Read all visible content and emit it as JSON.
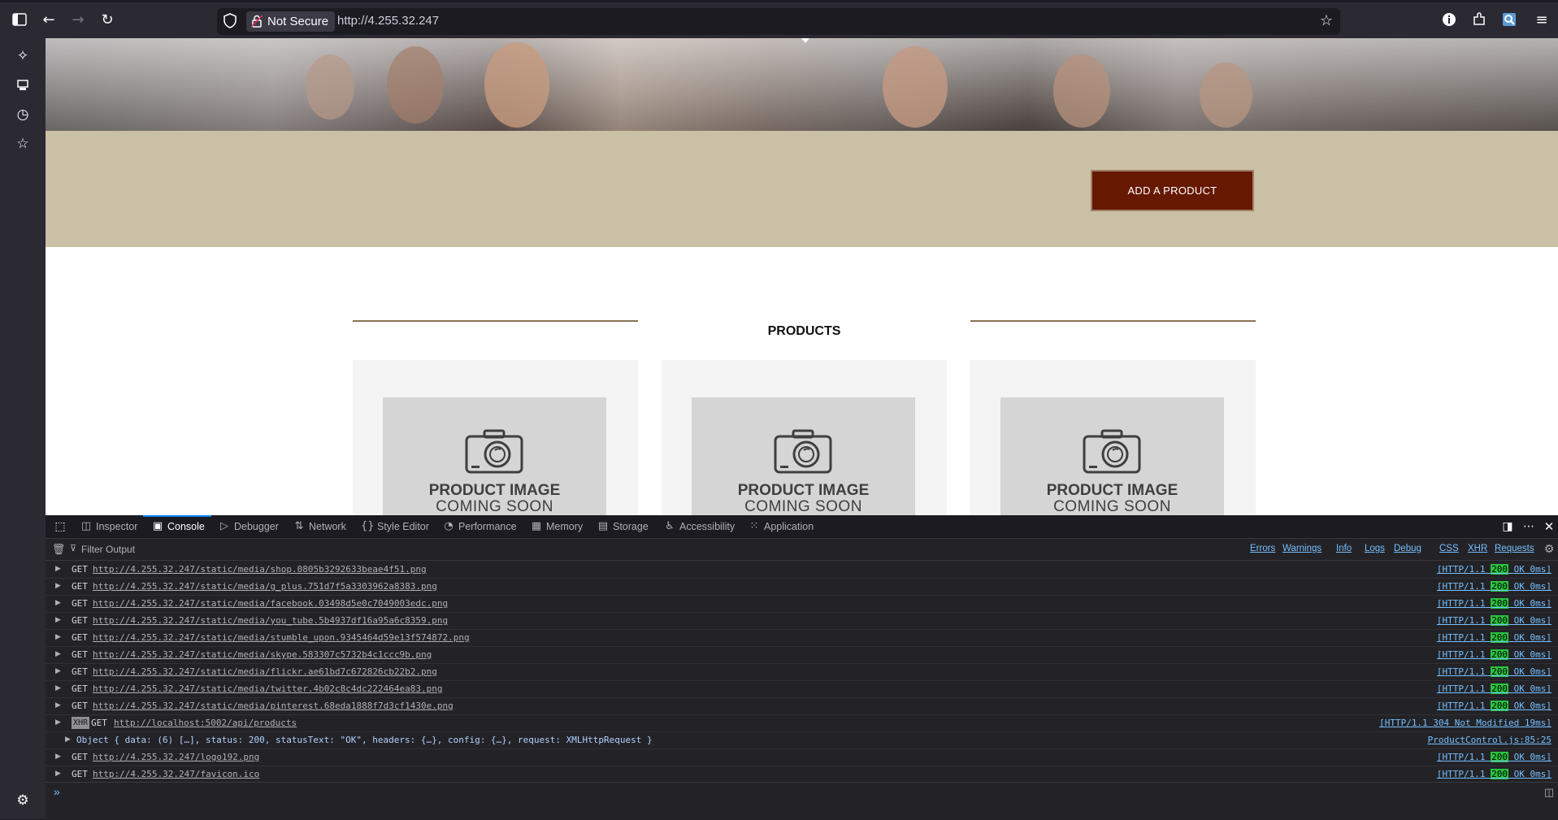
{
  "browser": {
    "security_label": "Not Secure",
    "url": "http://4.255.32.247"
  },
  "page": {
    "add_product_label": "ADD A PRODUCT",
    "products_title": "PRODUCTS",
    "cards": [
      {
        "line1": "PRODUCT IMAGE",
        "line2": "COMING SOON"
      },
      {
        "line1": "PRODUCT IMAGE",
        "line2": "COMING SOON"
      },
      {
        "line1": "PRODUCT IMAGE",
        "line2": "COMING SOON"
      }
    ],
    "colors": {
      "banner": "#c9c0a6",
      "button": "#661800",
      "rule": "#8b7355"
    }
  },
  "devtools": {
    "tabs": [
      "Inspector",
      "Console",
      "Debugger",
      "Network",
      "Style Editor",
      "Performance",
      "Memory",
      "Storage",
      "Accessibility",
      "Application"
    ],
    "selected_tab": "Console",
    "filter_placeholder": "Filter Output",
    "filter_buttons": [
      "Errors",
      "Warnings",
      "Info",
      "Logs",
      "Debug",
      "CSS",
      "XHR",
      "Requests"
    ],
    "logs": [
      {
        "method": "GET",
        "url": "http://4.255.32.247/static/media/shop.0805b3292633beae4f51.png",
        "status_pre": "[HTTP/1.1 ",
        "code": "200",
        "status_post": " OK 0ms]"
      },
      {
        "method": "GET",
        "url": "http://4.255.32.247/static/media/g_plus.751d7f5a3303962a8383.png",
        "status_pre": "[HTTP/1.1 ",
        "code": "200",
        "status_post": " OK 0ms]"
      },
      {
        "method": "GET",
        "url": "http://4.255.32.247/static/media/facebook.03498d5e0c7049003edc.png",
        "status_pre": "[HTTP/1.1 ",
        "code": "200",
        "status_post": " OK 0ms]"
      },
      {
        "method": "GET",
        "url": "http://4.255.32.247/static/media/you_tube.5b4937df16a95a6c8359.png",
        "status_pre": "[HTTP/1.1 ",
        "code": "200",
        "status_post": " OK 0ms]"
      },
      {
        "method": "GET",
        "url": "http://4.255.32.247/static/media/stumble_upon.9345464d59e13f574872.png",
        "status_pre": "[HTTP/1.1 ",
        "code": "200",
        "status_post": " OK 0ms]"
      },
      {
        "method": "GET",
        "url": "http://4.255.32.247/static/media/skype.583307c5732b4c1ccc9b.png",
        "status_pre": "[HTTP/1.1 ",
        "code": "200",
        "status_post": " OK 0ms]"
      },
      {
        "method": "GET",
        "url": "http://4.255.32.247/static/media/flickr.ae61bd7c672826cb22b2.png",
        "status_pre": "[HTTP/1.1 ",
        "code": "200",
        "status_post": " OK 0ms]"
      },
      {
        "method": "GET",
        "url": "http://4.255.32.247/static/media/twitter.4b02c8c4dc222464ea83.png",
        "status_pre": "[HTTP/1.1 ",
        "code": "200",
        "status_post": " OK 0ms]"
      },
      {
        "method": "GET",
        "url": "http://4.255.32.247/static/media/pinterest.68eda1888f7d3cf1430e.png",
        "status_pre": "[HTTP/1.1 ",
        "code": "200",
        "status_post": " OK 0ms]"
      }
    ],
    "xhr_log": {
      "badge": "XHR",
      "method": "GET",
      "url": "http://localhost:5002/api/products",
      "status": "[HTTP/1.1 304 Not Modified 19ms]"
    },
    "object_log": {
      "text": "Object { data: (6) […], status: 200, statusText: \"OK\", headers: {…}, config: {…}, request: XMLHttpRequest }",
      "source": "ProductControl.js:85:25"
    },
    "logs_after": [
      {
        "method": "GET",
        "url": "http://4.255.32.247/logo192.png",
        "status_pre": "[HTTP/1.1 ",
        "code": "200",
        "status_post": " OK 0ms]"
      },
      {
        "method": "GET",
        "url": "http://4.255.32.247/favicon.ico",
        "status_pre": "[HTTP/1.1 ",
        "code": "200",
        "status_post": " OK 0ms]"
      }
    ],
    "prompt_symbol": "»"
  }
}
